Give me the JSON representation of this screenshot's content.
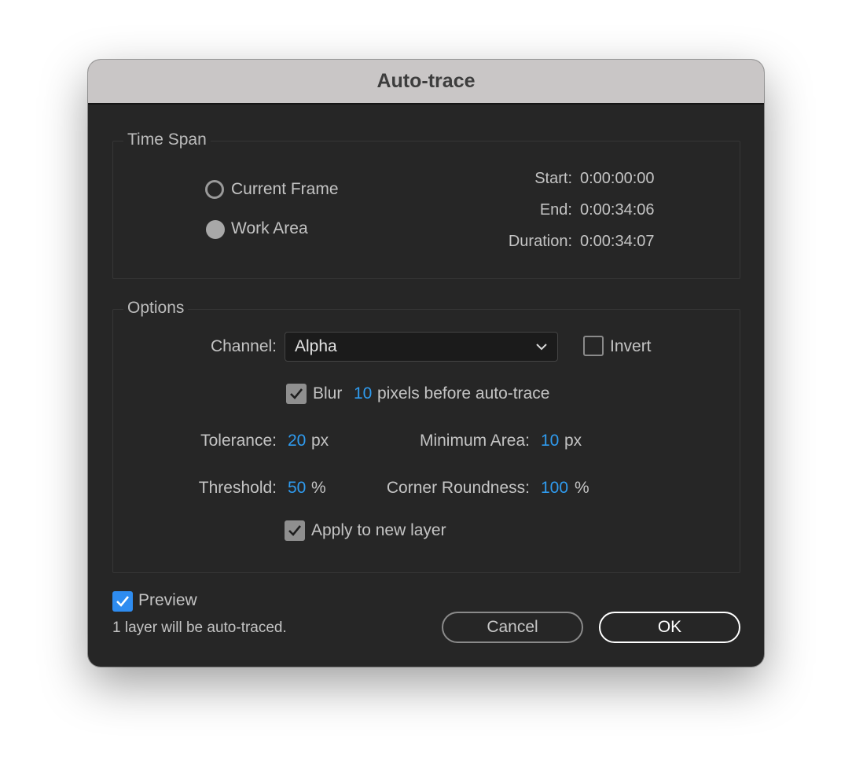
{
  "dialog": {
    "title": "Auto-trace"
  },
  "time_span": {
    "label": "Time Span",
    "options": [
      {
        "label": "Current Frame",
        "selected": false
      },
      {
        "label": "Work Area",
        "selected": true
      }
    ],
    "start_label": "Start:",
    "start_value": "0:00:00:00",
    "end_label": "End:",
    "end_value": "0:00:34:06",
    "duration_label": "Duration:",
    "duration_value": "0:00:34:07"
  },
  "options": {
    "label": "Options",
    "channel_label": "Channel:",
    "channel_value": "Alpha",
    "invert_label": "Invert",
    "invert_checked": false,
    "blur_label": "Blur",
    "blur_value": "10",
    "blur_suffix": "pixels before auto-trace",
    "blur_checked": true,
    "tolerance_label": "Tolerance:",
    "tolerance_value": "20",
    "tolerance_unit": "px",
    "min_area_label": "Minimum Area:",
    "min_area_value": "10",
    "min_area_unit": "px",
    "threshold_label": "Threshold:",
    "threshold_value": "50",
    "threshold_unit": "%",
    "corner_label": "Corner Roundness:",
    "corner_value": "100",
    "corner_unit": "%",
    "apply_label": "Apply to new layer",
    "apply_checked": true
  },
  "footer": {
    "preview_label": "Preview",
    "preview_checked": true,
    "status_text": "1 layer will be auto-traced.",
    "cancel_label": "Cancel",
    "ok_label": "OK"
  },
  "colors": {
    "accent_blue": "#2f9bef",
    "checkbox_blue": "#2e8cf0",
    "dialog_bg": "#262626",
    "titlebar_bg": "#c9c6c6"
  },
  "icons": {
    "dropdown": "chevron-down-icon",
    "check": "checkmark-icon"
  }
}
